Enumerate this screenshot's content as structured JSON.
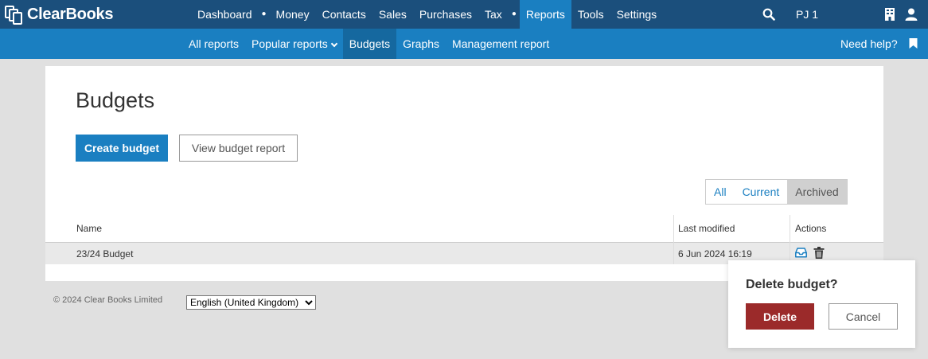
{
  "app": {
    "brand": "ClearBooks"
  },
  "topnav": {
    "items": [
      "Dashboard",
      "Money",
      "Contacts",
      "Sales",
      "Purchases",
      "Tax",
      "Reports",
      "Tools",
      "Settings"
    ],
    "active": "Reports",
    "user": "PJ 1"
  },
  "subnav": {
    "items": [
      "All reports",
      "Popular reports",
      "Budgets",
      "Graphs",
      "Management report"
    ],
    "active": "Budgets",
    "help": "Need help?"
  },
  "page": {
    "title": "Budgets",
    "create_button": "Create budget",
    "view_report_button": "View budget report",
    "filters": [
      "All",
      "Current",
      "Archived"
    ],
    "active_filter": "Archived"
  },
  "table": {
    "columns": [
      "Name",
      "Last modified",
      "Actions"
    ],
    "rows": [
      {
        "name": "23/24 Budget",
        "last_modified": "6 Jun 2024 16:19"
      }
    ]
  },
  "footer": {
    "copyright": "© 2024 Clear Books Limited",
    "language": "English (United Kingdom)"
  },
  "popover": {
    "title": "Delete budget?",
    "confirm": "Delete",
    "cancel": "Cancel"
  },
  "colors": {
    "topbar": "#1b4f7c",
    "subbar": "#1a7fc1",
    "primary": "#1a7fc1",
    "danger": "#9b2a2a"
  }
}
